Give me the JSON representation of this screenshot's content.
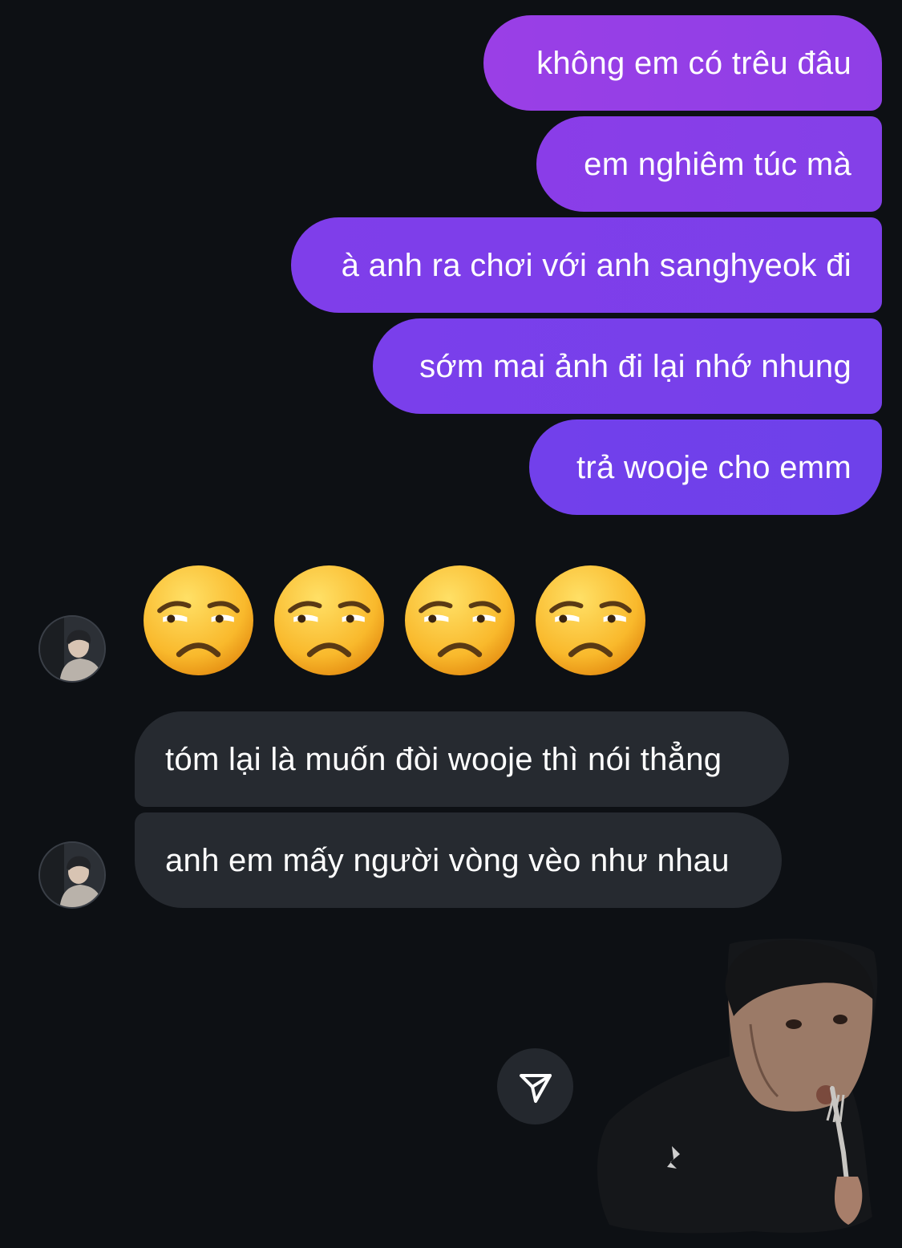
{
  "outgoing_messages": [
    {
      "text": "không em có trêu đâu"
    },
    {
      "text": "em nghiêm túc mà"
    },
    {
      "text": "à anh ra chơi với anh sanghyeok đi"
    },
    {
      "text": "sớm mai ảnh đi lại nhớ nhung"
    },
    {
      "text": "trả wooje cho emm"
    }
  ],
  "reaction": {
    "emoji": "😒",
    "count": 4,
    "icon_name": "unamused-face-icon"
  },
  "incoming_messages": [
    {
      "text": "tóm lại là muốn đòi wooje thì nói thẳng"
    },
    {
      "text": "anh em mấy người vòng vèo như nhau"
    }
  ],
  "send_button": {
    "icon_name": "paper-plane-icon"
  },
  "colors": {
    "background": "#0d1014",
    "outgoing_top": "#9a3fe6",
    "outgoing_bottom": "#6e41ea",
    "incoming": "#262a30",
    "text": "#ffffff"
  }
}
